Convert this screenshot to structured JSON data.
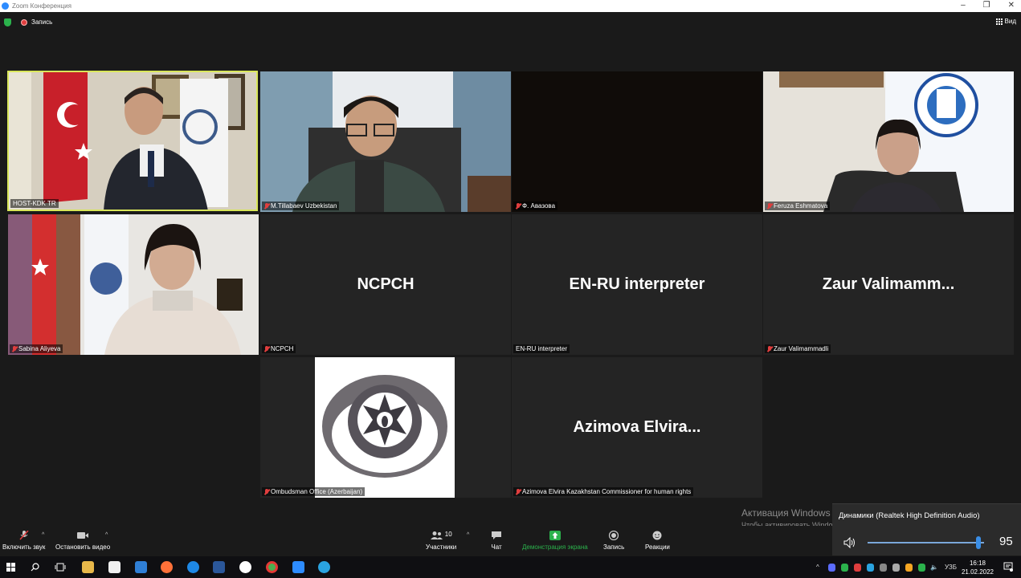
{
  "window": {
    "title": "Zoom Конференция"
  },
  "topbar": {
    "recording_label": "Запись",
    "view_label": "Вид"
  },
  "tiles": [
    {
      "name": "HOST-KDK TR",
      "big": ""
    },
    {
      "name": "M.Tillabaev Uzbekistan",
      "big": ""
    },
    {
      "name": "Ф. Авазова",
      "big": ""
    },
    {
      "name": "Feruza Eshmatova",
      "big": ""
    },
    {
      "name": "Sabina Aliyeva",
      "big": ""
    },
    {
      "name": "NCPCH",
      "big": "NCPCH"
    },
    {
      "name": "EN-RU interpreter",
      "big": "EN-RU interpreter"
    },
    {
      "name": "Zaur Valimammadli",
      "big": "Zaur  Valimamm..."
    },
    {
      "name": "Ombudsman Office (Azerbaijan)",
      "big": ""
    },
    {
      "name": "Azimova Elvira Kazakhstan Commissioner for human rights",
      "big": "Azimova  Elvira..."
    }
  ],
  "toolbar": {
    "unmute": "Включить звук",
    "start_video": "Остановить видео",
    "participants": "Участники",
    "participants_count": "10",
    "chat": "Чат",
    "share": "Демонстрация экрана",
    "record": "Запись",
    "reactions": "Реакции"
  },
  "activation": {
    "title": "Активация Windows",
    "text": "Чтобы активировать Windows, перейдите в раздел \"Параметры\"."
  },
  "volume": {
    "device": "Динамики (Realtek High Definition Audio)",
    "level": "95",
    "level_fraction": 0.95
  },
  "taskbar": {
    "lang": "УЗБ",
    "time": "16:18",
    "date": "21.02.2022"
  },
  "colors": {
    "active_speaker": "#d9e65a",
    "share_green": "#2bb24c",
    "muted_red": "#e03e3e"
  }
}
